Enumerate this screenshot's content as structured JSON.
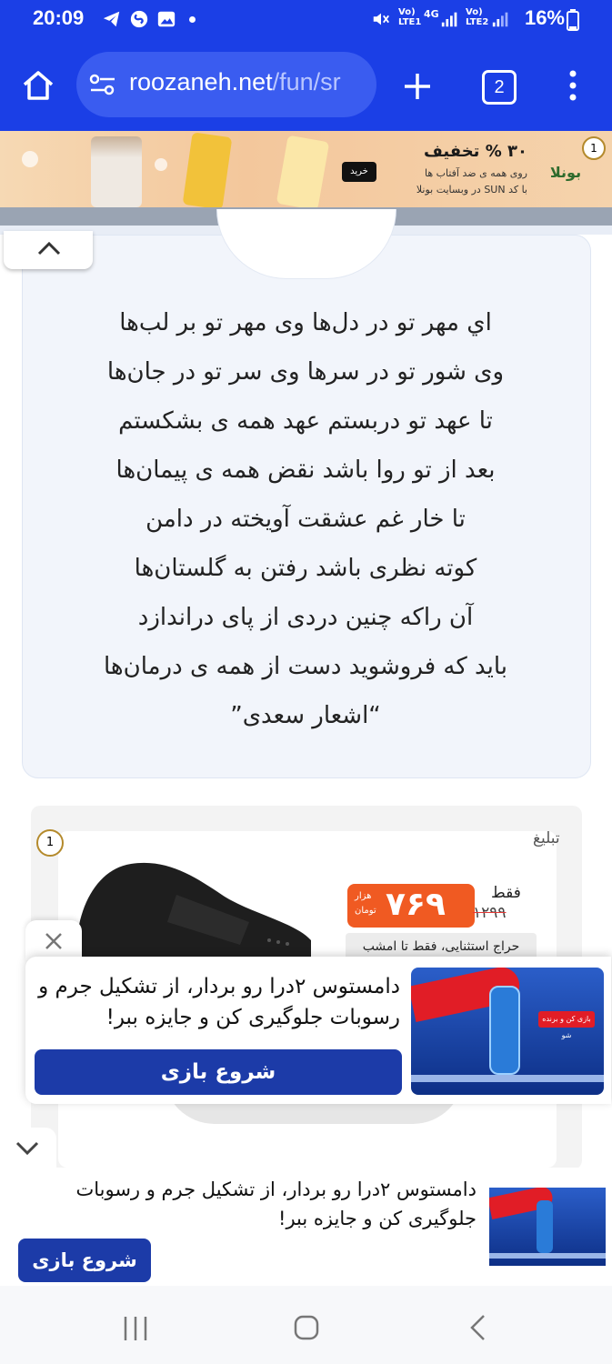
{
  "status_bar": {
    "time": "20:09",
    "battery": "16%",
    "sim1": "Vo) LTE1",
    "sim2": "Vo) LTE2",
    "network": "4G"
  },
  "browser": {
    "url_host": "roozaneh.net",
    "url_path": "/fun/sr",
    "tab_count": "2"
  },
  "top_ad": {
    "headline": "۳۰ % تخفیف",
    "line1": "روی همه ی ضد آفتاب ها",
    "line2": "با کد SUN در وبسایت بونلا",
    "buy_label": "خرید",
    "brand": "بونلا",
    "badge": "1"
  },
  "poem": {
    "lines": [
      "اي مهر تو در دل‌ها وی مهر تو بر لب‌ها",
      "وی شور تو در سرها وی سر تو در جان‌ها",
      "تا عهد تو دربستم عهد همه ی بشکستم",
      "بعد از تو روا باشد نقض همه ی پیمان‌ها",
      "تا خار غم عشقت آویخته در دامن",
      "کوته نظری باشد رفتن به گلستان‌ها",
      "آن راکه چنین دردی از پای دراندازد",
      "باید که فروشوید دست از همه ی درمان‌ها",
      "“اشعار سعدی”"
    ]
  },
  "product_ad": {
    "label": "تبلیغ",
    "only": "فقط",
    "price": "۷۶۹",
    "unit_top": "هزار",
    "unit_bottom": "تومان",
    "old_price": "۱۲۹۹",
    "sale": "حراج استثنایی، فقط تا امشب",
    "badge": "1"
  },
  "popup_ad": {
    "text": "دامستوس ۲درا رو بردار، از تشکیل جرم و رسوبات جلوگیری کن و جایزه ببر!",
    "cta": "شروع بازی",
    "image_caption": "بازی کن و برنده شو"
  },
  "bottom_ad": {
    "text": "دامستوس ۲درا رو بردار، از تشکیل جرم و رسوبات جلوگیری کن و جایزه ببر!",
    "cta": "شروع بازی"
  },
  "colors": {
    "chrome_blue": "#1b3fe6",
    "cta_blue": "#1c3ba8",
    "price_orange": "#f05a22"
  }
}
